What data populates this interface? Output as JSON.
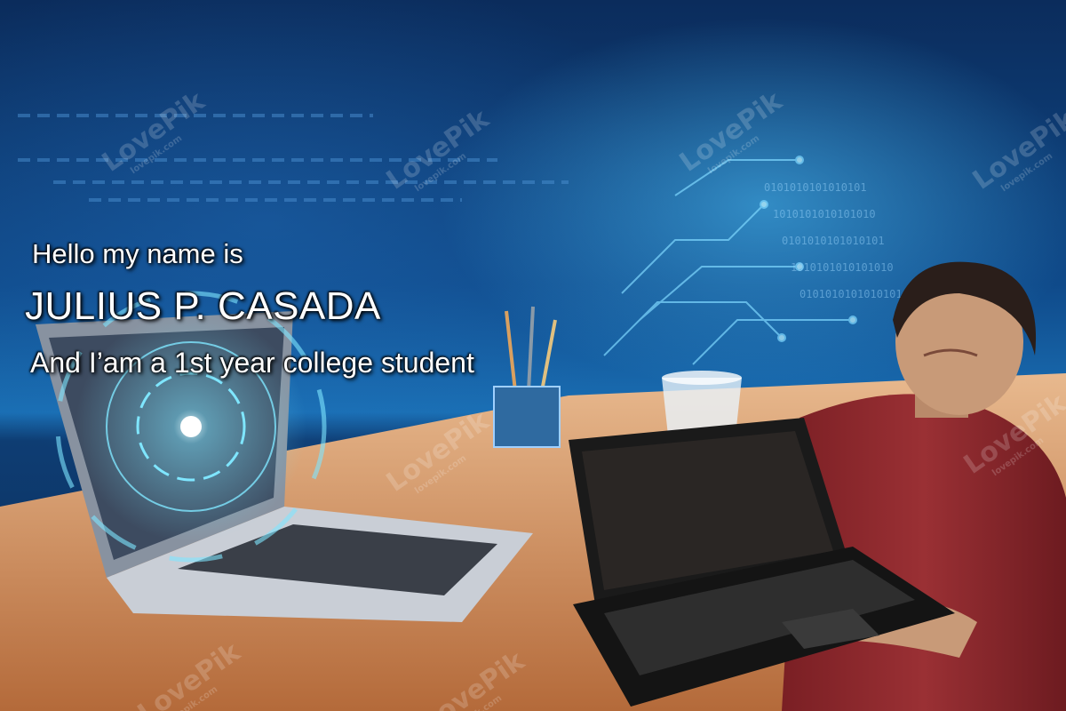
{
  "greeting": {
    "line1": "Hello my name is",
    "line2": "JULIUS P. CASADA",
    "line3": "And I’am a 1st year college student"
  },
  "watermark": {
    "brand": "LovePik",
    "site": "lovepik.com"
  },
  "colors": {
    "background_dark": "#0b2c5c",
    "background_glow": "#50c8ff",
    "desk": "#d69a6a",
    "shirt": "#8a2a2e",
    "laptop_black": "#1a1a1a",
    "laptop_silver": "#c9ced6",
    "hologram": "#7fe6ff",
    "text": "#ffffff"
  },
  "icons": [
    "circuit-board-icon",
    "binary-code-icon",
    "hologram-ring-icon",
    "pencil-cup-icon",
    "coffee-cup-icon"
  ]
}
